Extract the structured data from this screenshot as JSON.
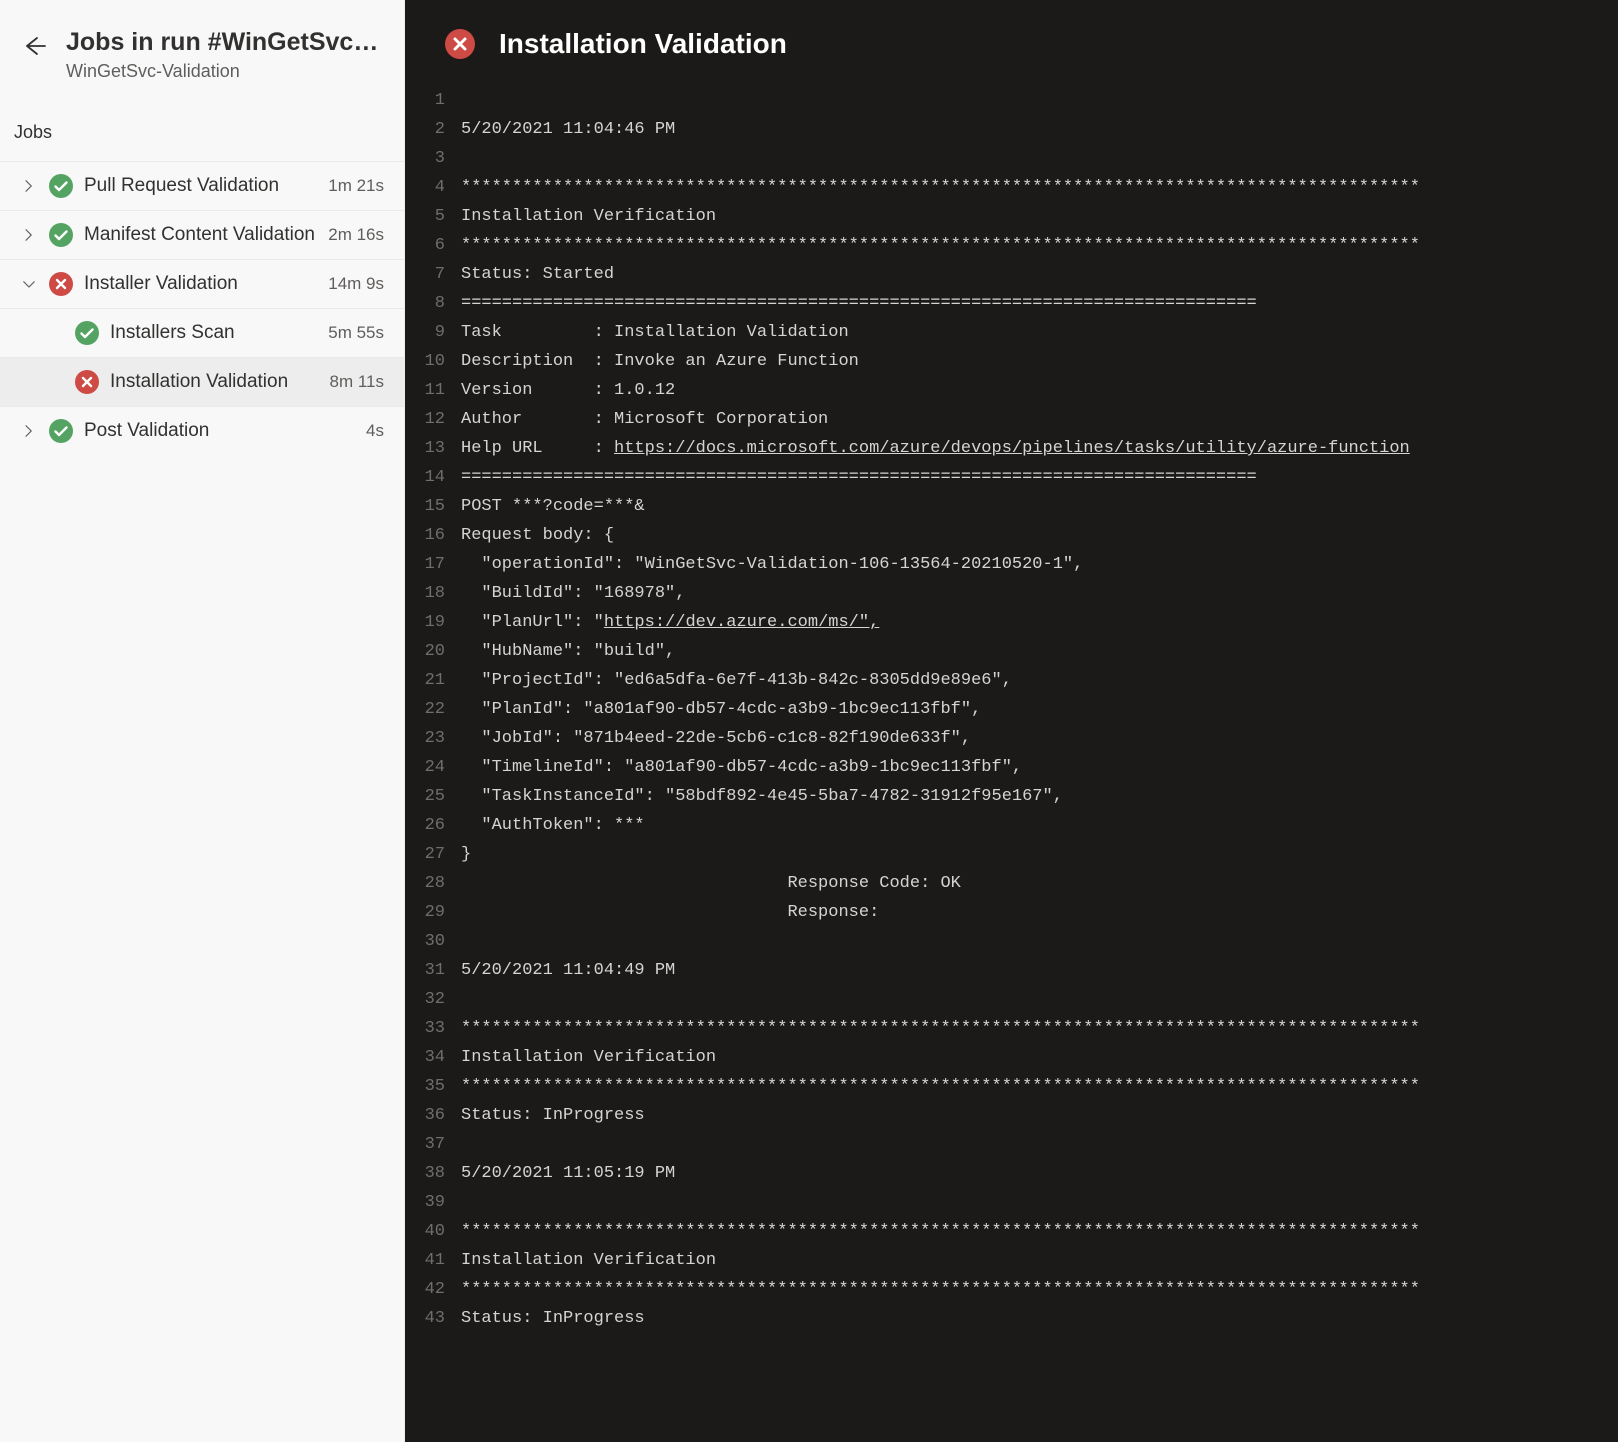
{
  "header": {
    "title": "Jobs in run #WinGetSvc-Valida…",
    "subtitle": "WinGetSvc-Validation"
  },
  "section_label": "Jobs",
  "jobs": [
    {
      "name": "Pull Request Validation",
      "status": "success",
      "expandable": true,
      "expanded": false,
      "duration": "1m 21s",
      "steps": []
    },
    {
      "name": "Manifest Content Validation",
      "status": "success",
      "expandable": true,
      "expanded": false,
      "duration": "2m 16s",
      "steps": []
    },
    {
      "name": "Installer Validation",
      "status": "error",
      "expandable": true,
      "expanded": true,
      "duration": "14m 9s",
      "steps": [
        {
          "name": "Installers Scan",
          "status": "success",
          "duration": "5m 55s",
          "active": false
        },
        {
          "name": "Installation Validation",
          "status": "error",
          "duration": "8m 11s",
          "active": true
        }
      ]
    },
    {
      "name": "Post Validation",
      "status": "success",
      "expandable": true,
      "expanded": false,
      "duration": "4s",
      "steps": []
    }
  ],
  "log": {
    "status_icon": "error",
    "title": "Installation Validation",
    "lines": [
      "",
      "5/20/2021 11:04:46 PM",
      "",
      "**********************************************************************************************",
      "Installation Verification",
      "**********************************************************************************************",
      "Status: Started",
      "==============================================================================",
      "Task         : Installation Validation",
      "Description  : Invoke an Azure Function",
      "Version      : 1.0.12",
      "Author       : Microsoft Corporation",
      {
        "prefix": "Help URL     : ",
        "link": "https://docs.microsoft.com/azure/devops/pipelines/tasks/utility/azure-function"
      },
      "==============================================================================",
      "POST ***?code=***&",
      "Request body: {",
      "  \"operationId\": \"WinGetSvc-Validation-106-13564-20210520-1\",",
      "  \"BuildId\": \"168978\",",
      {
        "prefix": "  \"PlanUrl\": \"",
        "link": "https://dev.azure.com/ms/\","
      },
      "  \"HubName\": \"build\",",
      "  \"ProjectId\": \"ed6a5dfa-6e7f-413b-842c-8305dd9e89e6\",",
      "  \"PlanId\": \"a801af90-db57-4cdc-a3b9-1bc9ec113fbf\",",
      "  \"JobId\": \"871b4eed-22de-5cb6-c1c8-82f190de633f\",",
      "  \"TimelineId\": \"a801af90-db57-4cdc-a3b9-1bc9ec113fbf\",",
      "  \"TaskInstanceId\": \"58bdf892-4e45-5ba7-4782-31912f95e167\",",
      "  \"AuthToken\": ***",
      "}",
      "                                Response Code: OK",
      "                                Response:",
      "",
      "5/20/2021 11:04:49 PM",
      "",
      "**********************************************************************************************",
      "Installation Verification",
      "**********************************************************************************************",
      "Status: InProgress",
      "",
      "5/20/2021 11:05:19 PM",
      "",
      "**********************************************************************************************",
      "Installation Verification",
      "**********************************************************************************************",
      "Status: InProgress"
    ]
  }
}
